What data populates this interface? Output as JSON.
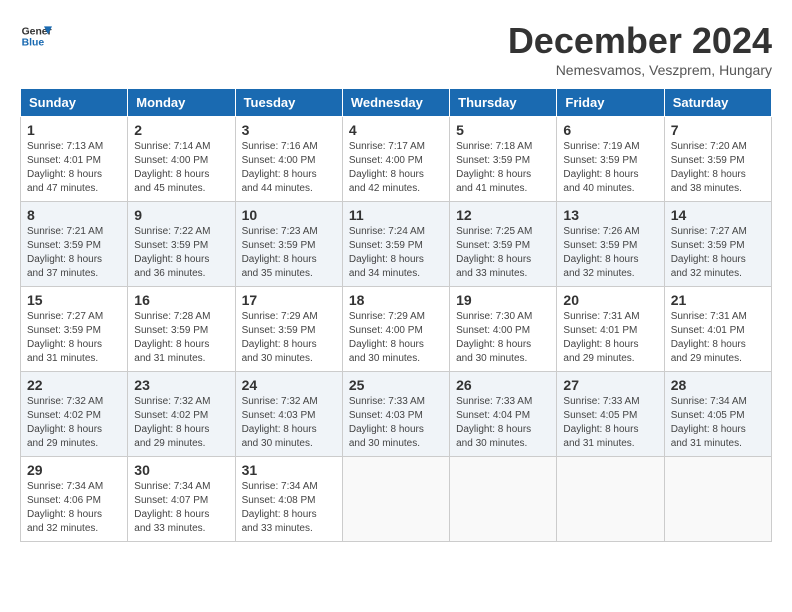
{
  "header": {
    "logo_general": "General",
    "logo_blue": "Blue",
    "month_title": "December 2024",
    "subtitle": "Nemesvamos, Veszprem, Hungary"
  },
  "weekdays": [
    "Sunday",
    "Monday",
    "Tuesday",
    "Wednesday",
    "Thursday",
    "Friday",
    "Saturday"
  ],
  "weeks": [
    [
      {
        "day": "1",
        "info": "Sunrise: 7:13 AM\nSunset: 4:01 PM\nDaylight: 8 hours\nand 47 minutes."
      },
      {
        "day": "2",
        "info": "Sunrise: 7:14 AM\nSunset: 4:00 PM\nDaylight: 8 hours\nand 45 minutes."
      },
      {
        "day": "3",
        "info": "Sunrise: 7:16 AM\nSunset: 4:00 PM\nDaylight: 8 hours\nand 44 minutes."
      },
      {
        "day": "4",
        "info": "Sunrise: 7:17 AM\nSunset: 4:00 PM\nDaylight: 8 hours\nand 42 minutes."
      },
      {
        "day": "5",
        "info": "Sunrise: 7:18 AM\nSunset: 3:59 PM\nDaylight: 8 hours\nand 41 minutes."
      },
      {
        "day": "6",
        "info": "Sunrise: 7:19 AM\nSunset: 3:59 PM\nDaylight: 8 hours\nand 40 minutes."
      },
      {
        "day": "7",
        "info": "Sunrise: 7:20 AM\nSunset: 3:59 PM\nDaylight: 8 hours\nand 38 minutes."
      }
    ],
    [
      {
        "day": "8",
        "info": "Sunrise: 7:21 AM\nSunset: 3:59 PM\nDaylight: 8 hours\nand 37 minutes."
      },
      {
        "day": "9",
        "info": "Sunrise: 7:22 AM\nSunset: 3:59 PM\nDaylight: 8 hours\nand 36 minutes."
      },
      {
        "day": "10",
        "info": "Sunrise: 7:23 AM\nSunset: 3:59 PM\nDaylight: 8 hours\nand 35 minutes."
      },
      {
        "day": "11",
        "info": "Sunrise: 7:24 AM\nSunset: 3:59 PM\nDaylight: 8 hours\nand 34 minutes."
      },
      {
        "day": "12",
        "info": "Sunrise: 7:25 AM\nSunset: 3:59 PM\nDaylight: 8 hours\nand 33 minutes."
      },
      {
        "day": "13",
        "info": "Sunrise: 7:26 AM\nSunset: 3:59 PM\nDaylight: 8 hours\nand 32 minutes."
      },
      {
        "day": "14",
        "info": "Sunrise: 7:27 AM\nSunset: 3:59 PM\nDaylight: 8 hours\nand 32 minutes."
      }
    ],
    [
      {
        "day": "15",
        "info": "Sunrise: 7:27 AM\nSunset: 3:59 PM\nDaylight: 8 hours\nand 31 minutes."
      },
      {
        "day": "16",
        "info": "Sunrise: 7:28 AM\nSunset: 3:59 PM\nDaylight: 8 hours\nand 31 minutes."
      },
      {
        "day": "17",
        "info": "Sunrise: 7:29 AM\nSunset: 3:59 PM\nDaylight: 8 hours\nand 30 minutes."
      },
      {
        "day": "18",
        "info": "Sunrise: 7:29 AM\nSunset: 4:00 PM\nDaylight: 8 hours\nand 30 minutes."
      },
      {
        "day": "19",
        "info": "Sunrise: 7:30 AM\nSunset: 4:00 PM\nDaylight: 8 hours\nand 30 minutes."
      },
      {
        "day": "20",
        "info": "Sunrise: 7:31 AM\nSunset: 4:01 PM\nDaylight: 8 hours\nand 29 minutes."
      },
      {
        "day": "21",
        "info": "Sunrise: 7:31 AM\nSunset: 4:01 PM\nDaylight: 8 hours\nand 29 minutes."
      }
    ],
    [
      {
        "day": "22",
        "info": "Sunrise: 7:32 AM\nSunset: 4:02 PM\nDaylight: 8 hours\nand 29 minutes."
      },
      {
        "day": "23",
        "info": "Sunrise: 7:32 AM\nSunset: 4:02 PM\nDaylight: 8 hours\nand 29 minutes."
      },
      {
        "day": "24",
        "info": "Sunrise: 7:32 AM\nSunset: 4:03 PM\nDaylight: 8 hours\nand 30 minutes."
      },
      {
        "day": "25",
        "info": "Sunrise: 7:33 AM\nSunset: 4:03 PM\nDaylight: 8 hours\nand 30 minutes."
      },
      {
        "day": "26",
        "info": "Sunrise: 7:33 AM\nSunset: 4:04 PM\nDaylight: 8 hours\nand 30 minutes."
      },
      {
        "day": "27",
        "info": "Sunrise: 7:33 AM\nSunset: 4:05 PM\nDaylight: 8 hours\nand 31 minutes."
      },
      {
        "day": "28",
        "info": "Sunrise: 7:34 AM\nSunset: 4:05 PM\nDaylight: 8 hours\nand 31 minutes."
      }
    ],
    [
      {
        "day": "29",
        "info": "Sunrise: 7:34 AM\nSunset: 4:06 PM\nDaylight: 8 hours\nand 32 minutes."
      },
      {
        "day": "30",
        "info": "Sunrise: 7:34 AM\nSunset: 4:07 PM\nDaylight: 8 hours\nand 33 minutes."
      },
      {
        "day": "31",
        "info": "Sunrise: 7:34 AM\nSunset: 4:08 PM\nDaylight: 8 hours\nand 33 minutes."
      },
      {
        "day": "",
        "info": ""
      },
      {
        "day": "",
        "info": ""
      },
      {
        "day": "",
        "info": ""
      },
      {
        "day": "",
        "info": ""
      }
    ]
  ]
}
